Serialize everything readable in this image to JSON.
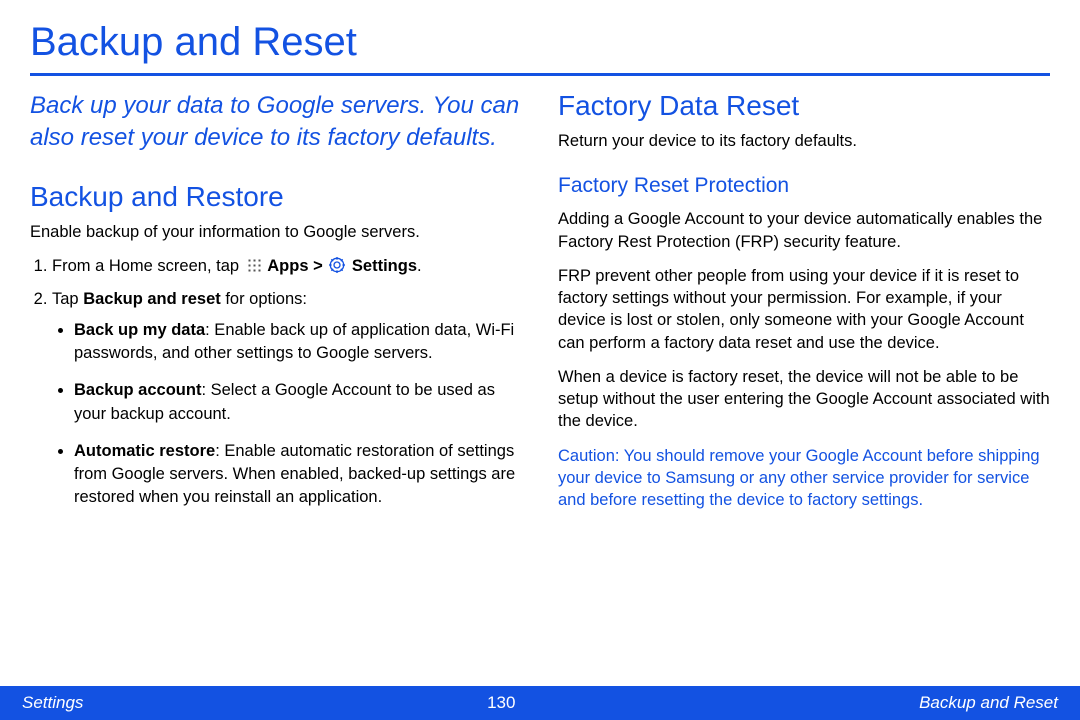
{
  "title": "Backup and Reset",
  "intro": "Back up your data to Google servers. You can also reset your device to its factory defaults.",
  "left": {
    "h2": "Backup and Restore",
    "lead": "Enable backup of your information to Google servers.",
    "step1_pre": "From a Home screen, tap ",
    "apps_label": "Apps",
    "gt": " > ",
    "settings_label": "Settings",
    "step1_post": ".",
    "step2_pre": "Tap ",
    "step2_bold": "Backup and reset",
    "step2_post": " for options:",
    "b1_title": "Back up my data",
    "b1_body": ": Enable back up of application data, Wi-Fi passwords, and other settings to Google servers.",
    "b2_title": "Backup account",
    "b2_body": ": Select a Google Account to be used as your backup account.",
    "b3_title": "Automatic restore",
    "b3_body": ": Enable automatic restoration of settings from Google servers. When enabled, backed-up settings are restored when you reinstall an application."
  },
  "right": {
    "h2": "Factory Data Reset",
    "lead": "Return your device to its factory defaults.",
    "h3": "Factory Reset Protection",
    "p1": "Adding a Google Account to your device automatically enables the Factory Rest Protection (FRP) security feature.",
    "p2": "FRP prevent other people from using your device if it is reset to factory settings without your permission.  For example, if your device is lost or stolen, only someone with your Google Account can perform a factory data reset and use the device.",
    "p3": "When a device is factory reset, the device will not be able to be setup without the user entering the Google Account associated with the device.",
    "caution_label": "Caution",
    "caution_body": ": You should remove your Google Account before shipping your device to Samsung or any other service provider for service and before resetting the device to factory settings."
  },
  "footer": {
    "left": "Settings",
    "page": "130",
    "right": "Backup and Reset"
  }
}
